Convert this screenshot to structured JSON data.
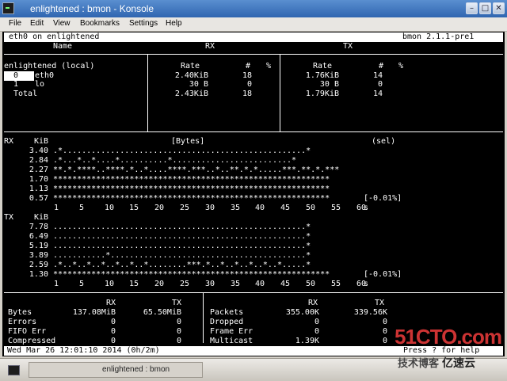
{
  "window": {
    "title": "enlightened : bmon - Konsole",
    "minimize": "–",
    "maximize": "□",
    "close": "✕"
  },
  "menu": [
    "File",
    "Edit",
    "View",
    "Bookmarks",
    "Settings",
    "Help"
  ],
  "bmon": {
    "host_line": "eth0 on enlightened",
    "version": "bmon 2.1.1-pre1",
    "headers": {
      "name": "Name",
      "rx": "RX",
      "tx": "TX"
    },
    "subheaders": {
      "rate": "Rate",
      "num": "#",
      "pct": "%"
    },
    "host_label": "enlightened (local)",
    "interfaces": [
      {
        "index": "0",
        "name": "eth0",
        "rx_rate": "2.40KiB",
        "rx_num": "18",
        "tx_rate": "1.76KiB",
        "tx_num": "14"
      },
      {
        "index": "1",
        "name": "lo",
        "rx_rate": "30 B",
        "rx_num": "0",
        "tx_rate": "30 B",
        "tx_num": "0"
      },
      {
        "index": "",
        "name": "Total",
        "rx_rate": "2.43KiB",
        "rx_num": "18",
        "tx_rate": "1.79KiB",
        "tx_num": "14"
      }
    ],
    "graph_rx": {
      "label": "RX",
      "unit": "KiB",
      "title": "[Bytes]",
      "sel": "(sel)",
      "rows": [
        {
          "y": "3.40",
          "bars": ".*...................................................*"
        },
        {
          "y": "2.84",
          "bars": ".*...*..*....*..........*.........................*"
        },
        {
          "y": "2.27",
          "bars": "**.*.****..****.*..*....****.***..*..**.*.*.....***.**.*.***"
        },
        {
          "y": "1.70",
          "bars": "**********************************************************"
        },
        {
          "y": "1.13",
          "bars": "**********************************************************"
        },
        {
          "y": "0.57",
          "bars": "**********************************************************"
        }
      ],
      "pct": "[-0.01%]"
    },
    "graph_tx": {
      "label": "TX",
      "unit": "KiB",
      "rows": [
        {
          "y": "7.78",
          "bars": ".....................................................*"
        },
        {
          "y": "6.49",
          "bars": ".....................................................*"
        },
        {
          "y": "5.19",
          "bars": ".....................................................*"
        },
        {
          "y": "3.89",
          "bars": "...........*.........................................*"
        },
        {
          "y": "2.59",
          "bars": ".*..*..*..*..*..*..*........***.*..*..*..*..*..*.....*"
        },
        {
          "y": "1.30",
          "bars": "**********************************************************"
        }
      ],
      "pct": "[-0.01%]"
    },
    "x_axis": [
      "1",
      "5",
      "10",
      "15",
      "20",
      "25",
      "30",
      "35",
      "40",
      "45",
      "50",
      "55",
      "60"
    ],
    "x_unit": "s",
    "stats": {
      "left_header": {
        "rx": "RX",
        "tx": "TX"
      },
      "left": [
        {
          "label": "Bytes",
          "rx": "137.08MiB",
          "tx": "65.50MiB"
        },
        {
          "label": "Errors",
          "rx": "0",
          "tx": "0"
        },
        {
          "label": "FIFO Err",
          "rx": "0",
          "tx": "0"
        },
        {
          "label": "Compressed",
          "rx": "0",
          "tx": "0"
        }
      ],
      "right_header": {
        "rx": "RX",
        "tx": "TX"
      },
      "right": [
        {
          "label": "Packets",
          "rx": "355.00K",
          "tx": "339.56K"
        },
        {
          "label": "Dropped",
          "rx": "0",
          "tx": "0"
        },
        {
          "label": "Frame Err",
          "rx": "0",
          "tx": "0"
        },
        {
          "label": "Multicast",
          "rx": "1.39K",
          "tx": "0"
        }
      ]
    },
    "status": "Wed Mar 26 12:01:10 2014 (0h/2m)",
    "help": "Press ? for help"
  },
  "taskbar": {
    "label": "enlightened : bmon"
  },
  "watermark": {
    "main": "51CTO.com",
    "sub": "技术博客",
    "logo": "亿速云"
  }
}
